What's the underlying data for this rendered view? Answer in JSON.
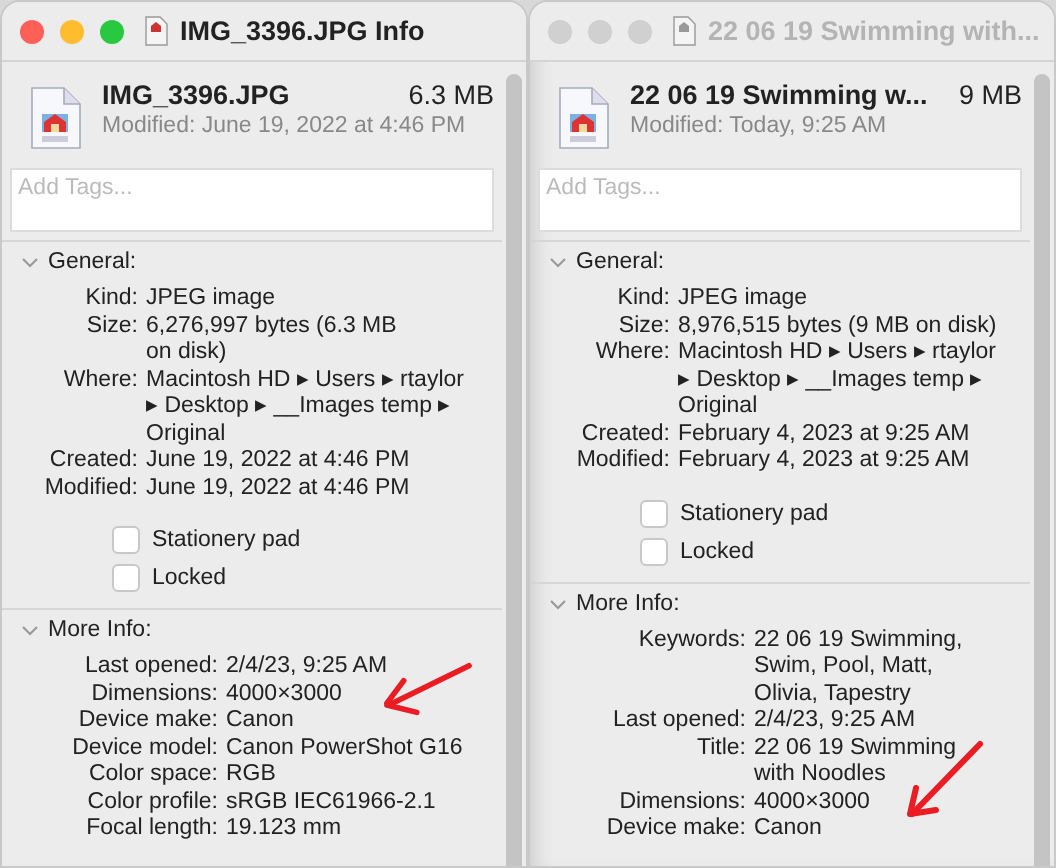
{
  "windows": [
    {
      "title": "IMG_3396.JPG Info",
      "active": true,
      "file": {
        "name": "IMG_3396.JPG",
        "size": "6.3 MB",
        "modified": "Modified: June 19, 2022 at 4:46 PM"
      },
      "tags": {
        "placeholder": "Add Tags..."
      },
      "general": {
        "title": "General:",
        "expanded": true,
        "rows": [
          {
            "label": "Kind:",
            "lines": [
              "JPEG image"
            ]
          },
          {
            "label": "Size:",
            "lines": [
              "6,276,997 bytes (6.3 MB",
              "on disk)"
            ]
          },
          {
            "label": "Where:",
            "lines": [
              "Macintosh HD ▸ Users ▸ rtaylor",
              "▸ Desktop ▸ __Images temp ▸",
              "Original"
            ]
          },
          {
            "label": "Created:",
            "lines": [
              "June 19, 2022 at 4:46 PM"
            ]
          },
          {
            "label": "Modified:",
            "lines": [
              "June 19, 2022 at 4:46 PM"
            ]
          }
        ]
      },
      "checkboxes": [
        {
          "label": "Stationery pad",
          "checked": false
        },
        {
          "label": "Locked",
          "checked": false
        }
      ],
      "more_info": {
        "title": "More Info:",
        "expanded": true,
        "rows": [
          {
            "label": "Last opened:",
            "lines": [
              "2/4/23, 9:25 AM"
            ]
          },
          {
            "label": "Dimensions:",
            "lines": [
              "4000×3000"
            ]
          },
          {
            "label": "Device make:",
            "lines": [
              "Canon"
            ]
          },
          {
            "label": "Device model:",
            "lines": [
              "Canon PowerShot G16"
            ]
          },
          {
            "label": "Color space:",
            "lines": [
              "RGB"
            ]
          },
          {
            "label": "Color profile:",
            "lines": [
              "sRGB IEC61966-2.1"
            ]
          },
          {
            "label": "Focal length:",
            "lines": [
              "19.123 mm"
            ]
          }
        ]
      }
    },
    {
      "title": "22 06 19 Swimming with...",
      "active": false,
      "file": {
        "name": "22 06 19 Swimming w...",
        "size": "9 MB",
        "modified": "Modified: Today, 9:25 AM"
      },
      "tags": {
        "placeholder": "Add Tags..."
      },
      "general": {
        "title": "General:",
        "expanded": true,
        "rows": [
          {
            "label": "Kind:",
            "lines": [
              "JPEG image"
            ]
          },
          {
            "label": "Size:",
            "lines": [
              "8,976,515 bytes (9 MB on disk)"
            ]
          },
          {
            "label": "Where:",
            "lines": [
              "Macintosh HD ▸ Users ▸ rtaylor",
              "▸ Desktop ▸ __Images temp ▸",
              "Original"
            ]
          },
          {
            "label": "Created:",
            "lines": [
              "February 4, 2023 at 9:25 AM"
            ]
          },
          {
            "label": "Modified:",
            "lines": [
              "February 4, 2023 at 9:25 AM"
            ]
          }
        ]
      },
      "checkboxes": [
        {
          "label": "Stationery pad",
          "checked": false
        },
        {
          "label": "Locked",
          "checked": false
        }
      ],
      "more_info": {
        "title": "More Info:",
        "expanded": true,
        "rows": [
          {
            "label": "Keywords:",
            "lines": [
              "22 06 19 Swimming,",
              "Swim, Pool, Matt,",
              "Olivia, Tapestry"
            ]
          },
          {
            "label": "Last opened:",
            "lines": [
              "2/4/23, 9:25 AM"
            ]
          },
          {
            "label": "Title:",
            "lines": [
              "22 06 19 Swimming",
              "with Noodles"
            ]
          },
          {
            "label": "Dimensions:",
            "lines": [
              "4000×3000"
            ]
          },
          {
            "label": "Device make:",
            "lines": [
              "Canon"
            ]
          }
        ]
      }
    }
  ]
}
